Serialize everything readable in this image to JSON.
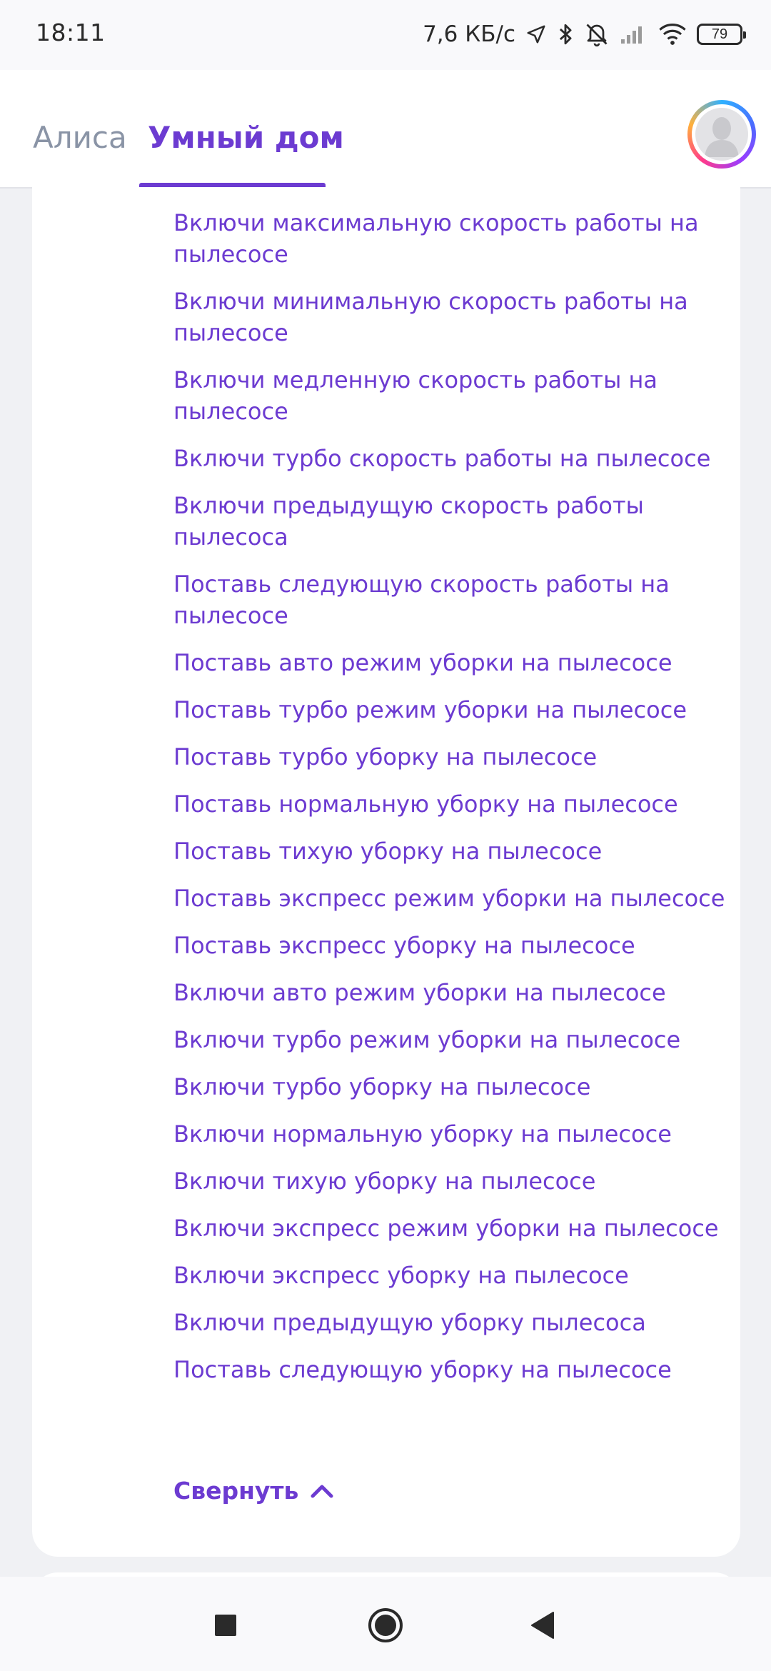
{
  "status_bar": {
    "time": "18:11",
    "network_speed": "7,6 КБ/с",
    "battery_level": "79",
    "icons": [
      "navigation-icon",
      "bluetooth-icon",
      "mute-alarm-icon",
      "signal-icon",
      "wifi-icon",
      "battery-icon"
    ]
  },
  "header": {
    "tabs": [
      {
        "label": "Алиса",
        "active": false
      },
      {
        "label": "Умный дом",
        "active": true
      }
    ],
    "accent_color": "#6c3bd1",
    "inactive_color": "#8a94a6"
  },
  "commands": [
    "Включи максимальную скорость работы на пылесосе",
    "Включи минимальную скорость работы на пылесосе",
    "Включи медленную скорость работы на пылесосе",
    "Включи турбо скорость работы на пылесосе",
    "Включи предыдущую скорость работы пылесоса",
    "Поставь следующую скорость работы на пылесосе",
    "Поставь авто режим уборки на пылесосе",
    "Поставь турбо режим уборки на пылесосе",
    "Поставь турбо уборку на пылесосе",
    "Поставь нормальную уборку на пылесосе",
    "Поставь тихую уборку на пылесосе",
    "Поставь экспресс режим уборки на пылесосе",
    "Поставь экспресс уборку на пылесосе",
    "Включи авто режим уборки на пылесосе",
    "Включи турбо режим уборки на пылесосе",
    "Включи турбо уборку на пылесосе",
    "Включи нормальную уборку на пылесосе",
    "Включи тихую уборку на пылесосе",
    "Включи экспресс режим уборки на пылесосе",
    "Включи экспресс уборку на пылесосе",
    "Включи предыдущую уборку пылесоса",
    "Поставь следующую уборку на пылесосе"
  ],
  "collapse_label": "Свернуть",
  "nav_bar": {
    "buttons": [
      "recent-apps-icon",
      "home-icon",
      "back-icon"
    ]
  }
}
